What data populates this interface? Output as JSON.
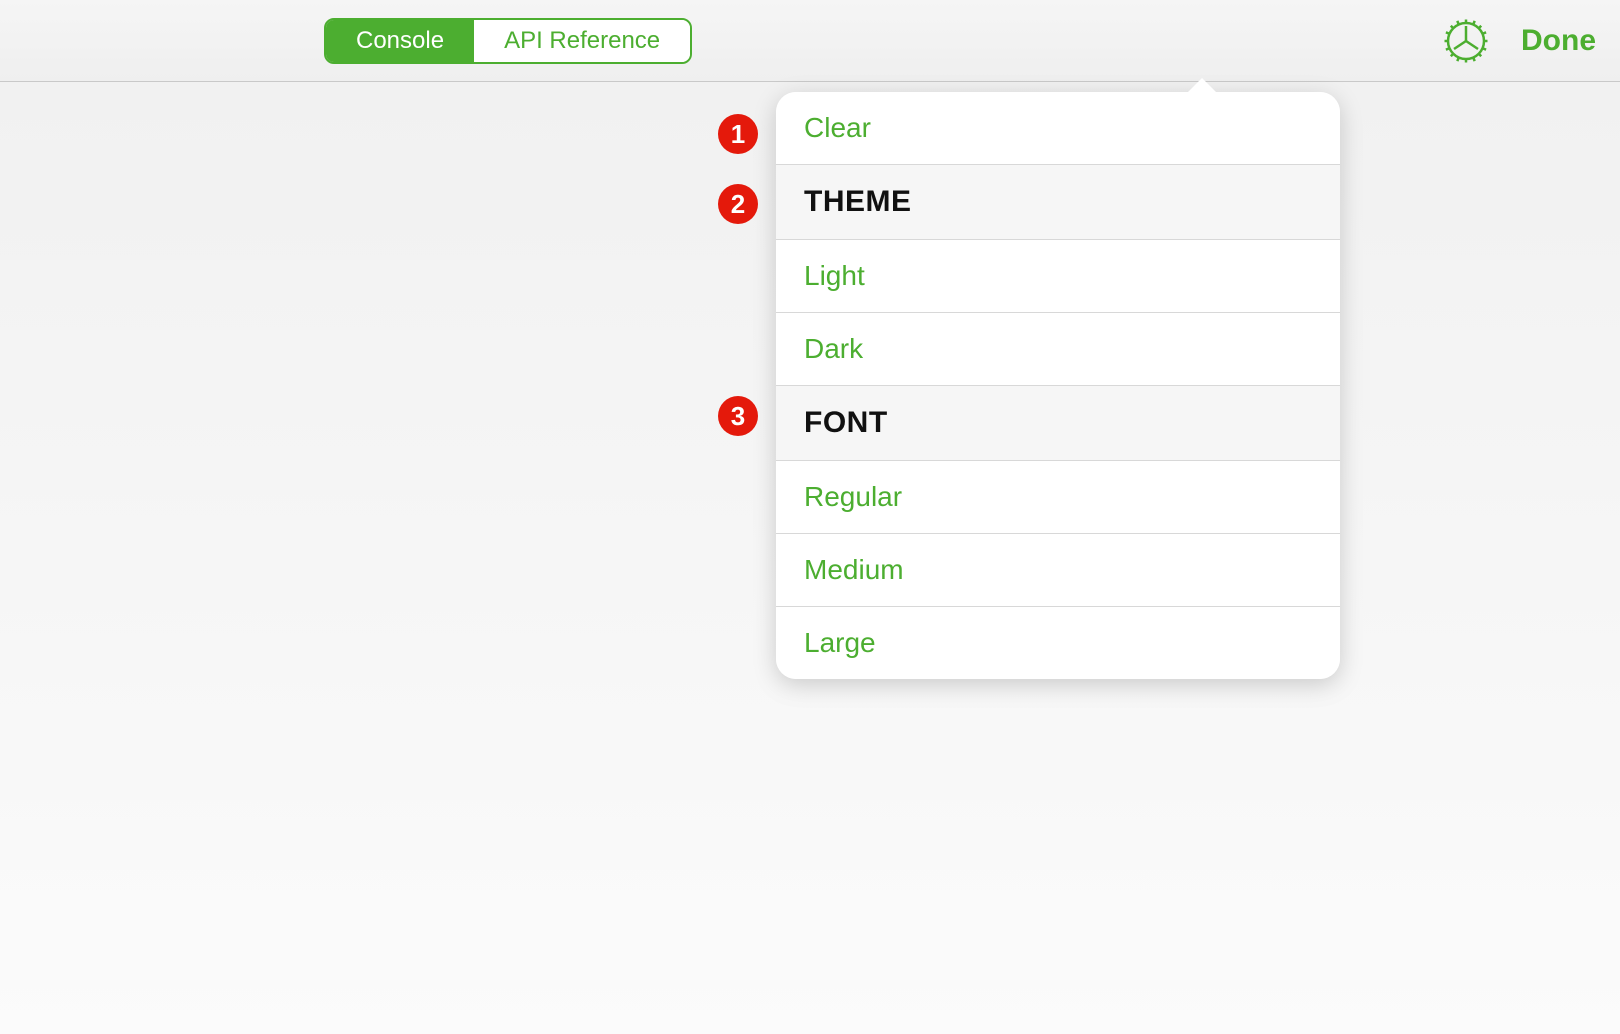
{
  "toolbar": {
    "segments": {
      "console": "Console",
      "api_reference": "API Reference"
    },
    "done_label": "Done"
  },
  "popover": {
    "clear_label": "Clear",
    "theme_header": "THEME",
    "theme_options": {
      "light": "Light",
      "dark": "Dark"
    },
    "font_header": "FONT",
    "font_options": {
      "regular": "Regular",
      "medium": "Medium",
      "large": "Large"
    }
  },
  "annotations": {
    "badge_1": "1",
    "badge_2": "2",
    "badge_3": "3"
  },
  "colors": {
    "accent": "#4cae30",
    "annotation": "#e4190b"
  }
}
